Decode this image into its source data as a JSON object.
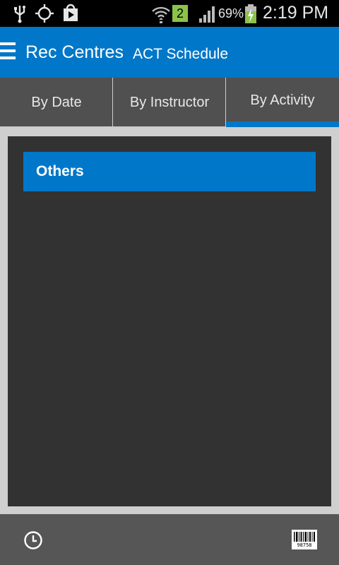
{
  "status_bar": {
    "icons": [
      "usb-icon",
      "gps-icon",
      "play-store-icon",
      "wifi-icon",
      "sim-2-icon",
      "signal-icon",
      "battery-charging-icon"
    ],
    "sim_badge": "2",
    "battery": "69%",
    "time": "2:19 PM"
  },
  "app_bar": {
    "title": "Rec Centres",
    "subtitle": "ACT Schedule",
    "accent_color": "#0077c8"
  },
  "tabs": [
    {
      "label": "By Date",
      "selected": false
    },
    {
      "label": "By Instructor",
      "selected": false
    },
    {
      "label": "By Activity",
      "selected": true
    }
  ],
  "list": {
    "categories": [
      {
        "label": "Others"
      }
    ]
  },
  "bottom_bar": {
    "left_icon": "clock-icon",
    "right_icon": "barcode-icon",
    "barcode_number": "98758"
  }
}
